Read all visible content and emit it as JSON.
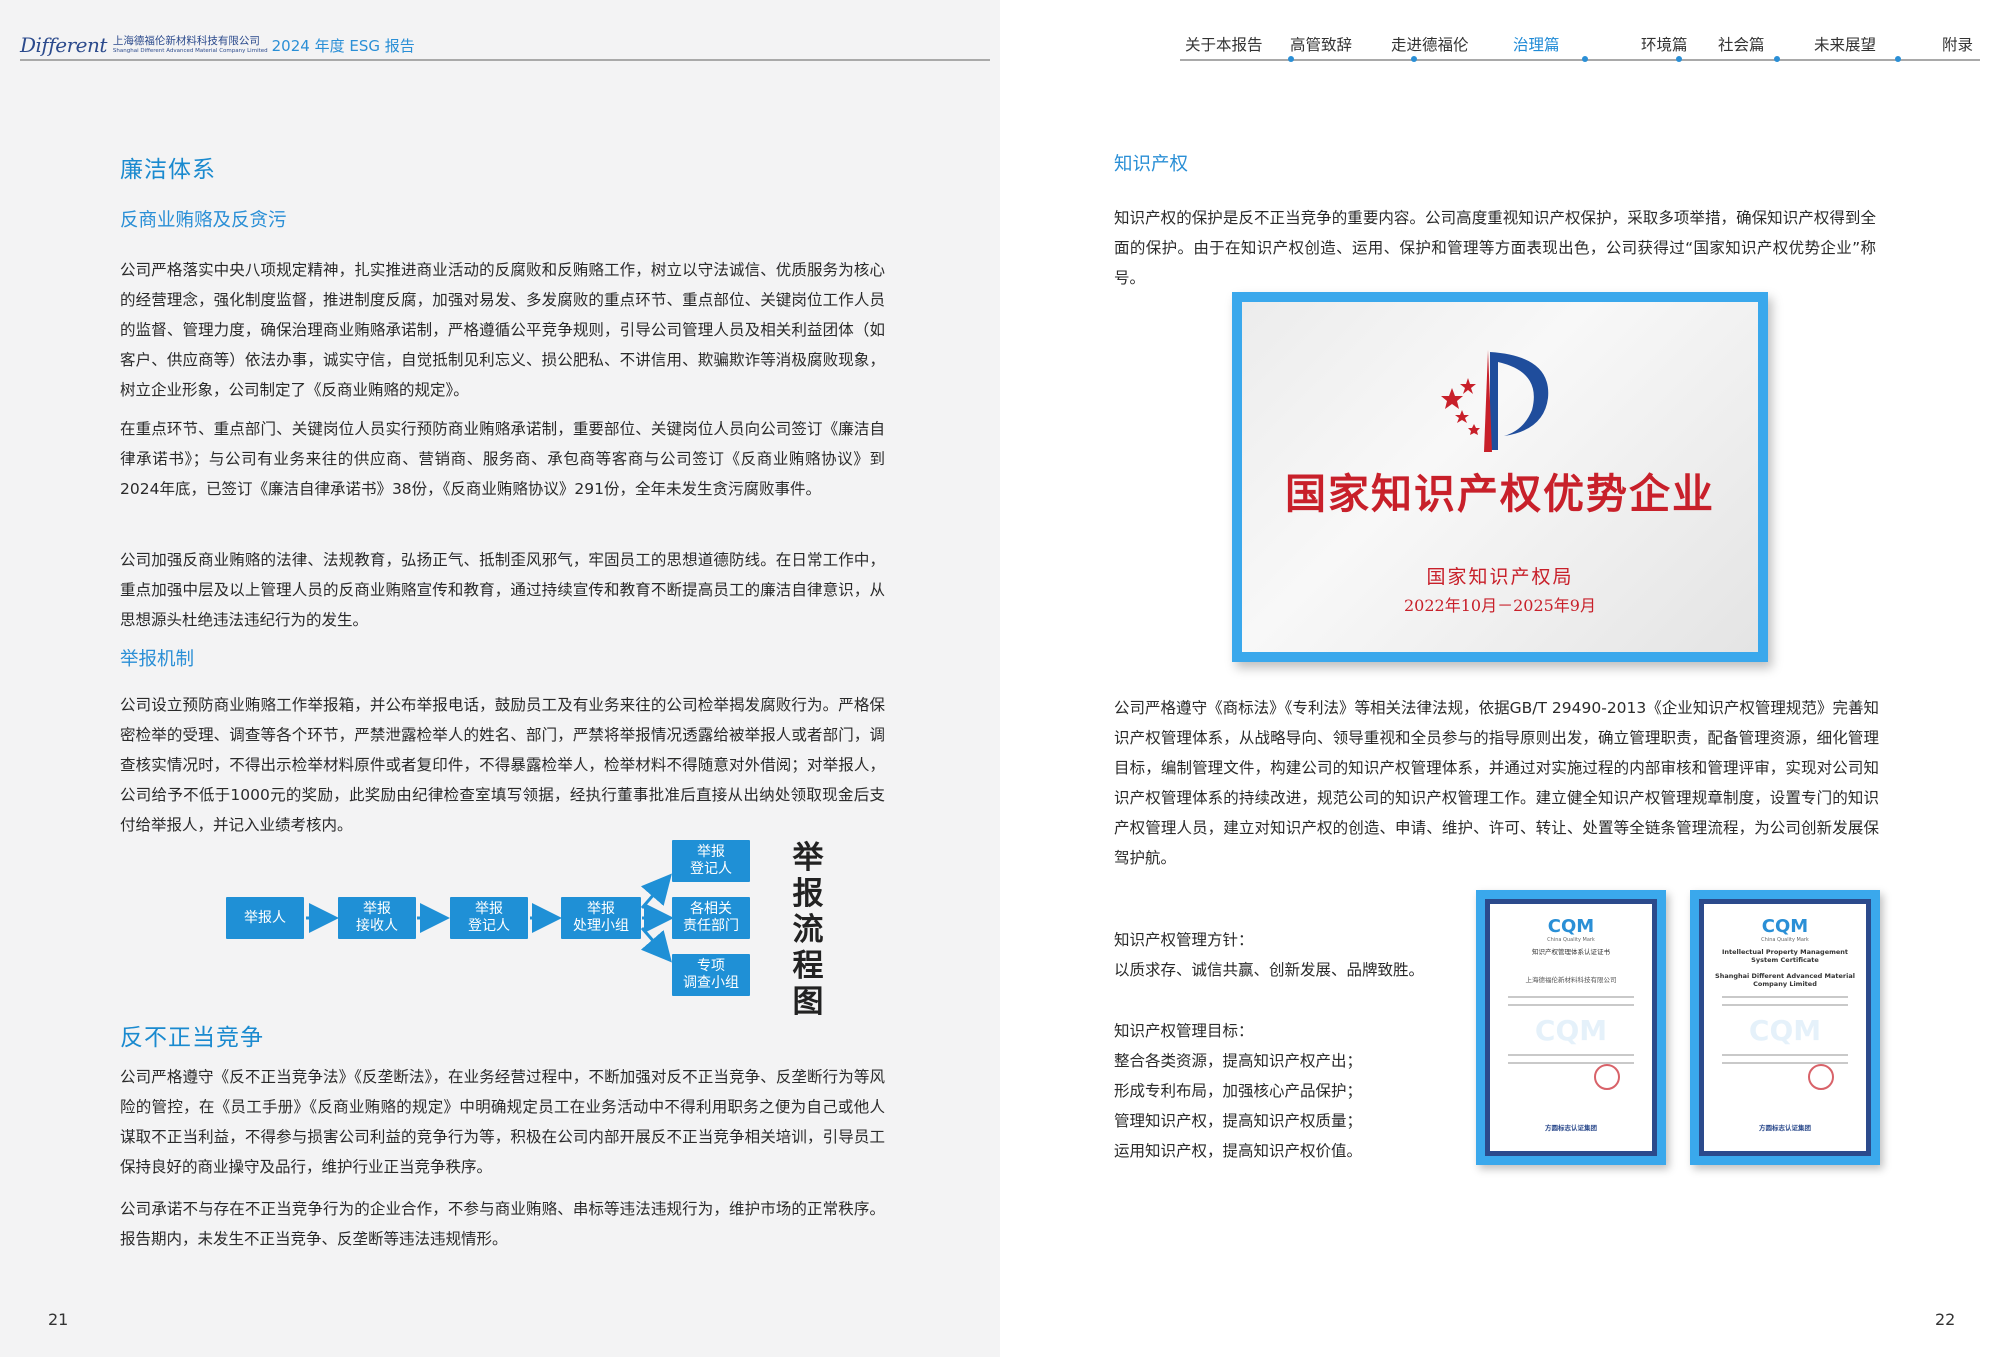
{
  "header": {
    "logo": "Different",
    "company_cn": "上海德福伦新材料科技有限公司",
    "company_en": "Shanghai Different Advanced Material Company Limited",
    "report_title": "2024 年度 ESG 报告",
    "nav": [
      "关于本报告",
      "高管致辞",
      "走进德福伦",
      "治理篇",
      "环境篇",
      "社会篇",
      "未来展望",
      "附录"
    ],
    "active_nav": "治理篇"
  },
  "left": {
    "section_title": "廉洁体系",
    "sub1_title": "反商业贿赂及反贪污",
    "p1": "公司严格落实中央八项规定精神，扎实推进商业活动的反腐败和反贿赂工作，树立以守法诚信、优质服务为核心的经营理念，强化制度监督，推进制度反腐，加强对易发、多发腐败的重点环节、重点部位、关键岗位工作人员的监督、管理力度，确保治理商业贿赂承诺制，严格遵循公平竞争规则，引导公司管理人员及相关利益团体（如客户、供应商等）依法办事，诚实守信，自觉抵制见利忘义、损公肥私、不讲信用、欺骗欺诈等消极腐败现象，树立企业形象，公司制定了《反商业贿赂的规定》。",
    "p2": "在重点环节、重点部门、关键岗位人员实行预防商业贿赂承诺制，重要部位、关键岗位人员向公司签订《廉洁自律承诺书》；与公司有业务来往的供应商、营销商、服务商、承包商等客商与公司签订《反商业贿赂协议》到2024年底，已签订《廉洁自律承诺书》38份，《反商业贿赂协议》291份，全年未发生贪污腐败事件。",
    "p3": "公司加强反商业贿赂的法律、法规教育，弘扬正气、抵制歪风邪气，牢固员工的思想道德防线。在日常工作中，重点加强中层及以上管理人员的反商业贿赂宣传和教育，通过持续宣传和教育不断提高员工的廉洁自律意识，从思想源头杜绝违法违纪行为的发生。",
    "sub2_title": "举报机制",
    "p4": "公司设立预防商业贿赂工作举报箱，并公布举报电话，鼓励员工及有业务来往的公司检举揭发腐败行为。严格保密检举的受理、调查等各个环节，严禁泄露检举人的姓名、部门，严禁将举报情况透露给被举报人或者部门，调查核实情况时，不得出示检举材料原件或者复印件，不得暴露检举人，检举材料不得随意对外借阅；对举报人，公司给予不低于1000元的奖励，此奖励由纪律检查室填写领据，经执行董事批准后直接从出纳处领取现金后支付给举报人，并记入业绩考核内。",
    "flow": {
      "title": "举报流程图",
      "nodes": [
        "举报人",
        "举报\n接收人",
        "举报\n登记人",
        "举报\n处理小组",
        "举报\n登记人",
        "各相关\n责任部门",
        "专项\n调查小组"
      ]
    },
    "section2_title": "反不正当竞争",
    "p5": "公司严格遵守《反不正当竞争法》《反垄断法》，在业务经营过程中，不断加强对反不正当竞争、反垄断行为等风险的管控，在《员工手册》《反商业贿赂的规定》中明确规定员工在业务活动中不得利用职务之便为自己或他人谋取不正当利益，不得参与损害公司利益的竞争行为等，积极在公司内部开展反不正当竞争相关培训，引导员工保持良好的商业操守及品行，维护行业正当竞争秩序。",
    "p6": "公司承诺不与存在不正当竞争行为的企业合作，不参与商业贿赂、串标等违法违规行为，维护市场的正常秩序。报告期内，未发生不正当竞争、反垄断等违法违规情形。",
    "page_number": "21"
  },
  "right": {
    "section_title": "知识产权",
    "p1": "知识产权的保护是反不正当竞争的重要内容。公司高度重视知识产权保护，采取多项举措，确保知识产权得到全面的保护。由于在知识产权创造、运用、保护和管理等方面表现出色，公司获得过“国家知识产权优势企业”称号。",
    "plaque": {
      "title": "国家知识产权优势企业",
      "issuer": "国家知识产权局",
      "date": "2022年10月－2025年9月"
    },
    "p2": "公司严格遵守《商标法》《专利法》等相关法律法规，依据GB/T 29490-2013《企业知识产权管理规范》完善知识产权管理体系，从战略导向、领导重视和全员参与的指导原则出发，确立管理职责，配备管理资源，细化管理目标，编制管理文件，构建公司的知识产权管理体系，并通过对实施过程的内部审核和管理评审，实现对公司知识产权管理体系的持续改进，规范公司的知识产权管理工作。建立健全知识产权管理规章制度，设置专门的知识产权管理人员，建立对知识产权的创造、申请、维护、许可、转让、处置等全链条管理流程，为公司创新发展保驾护航。",
    "policy_label": "知识产权管理方针：",
    "policy_text": "以质求存、诚信共赢、创新发展、品牌致胜。",
    "goal_label": "知识产权管理目标：",
    "goals": [
      "整合各类资源，提高知识产权产出；",
      "形成专利布局，加强核心产品保护；",
      "管理知识产权，提高知识产权质量；",
      "运用知识产权，提高知识产权价值。"
    ],
    "cert_cn": {
      "logo": "CQM",
      "sub": "China Quality Mark",
      "title": "知识产权管理体系认证证书",
      "company": "上海德福伦新材料科技有限公司",
      "footer": "方圆标志认证集团"
    },
    "cert_en": {
      "logo": "CQM",
      "sub": "China Quality Mark",
      "title": "Intellectual Property Management System Certificate",
      "company": "Shanghai Different Advanced Material Company Limited",
      "footer": "方圆标志认证集团"
    },
    "page_number": "22"
  }
}
